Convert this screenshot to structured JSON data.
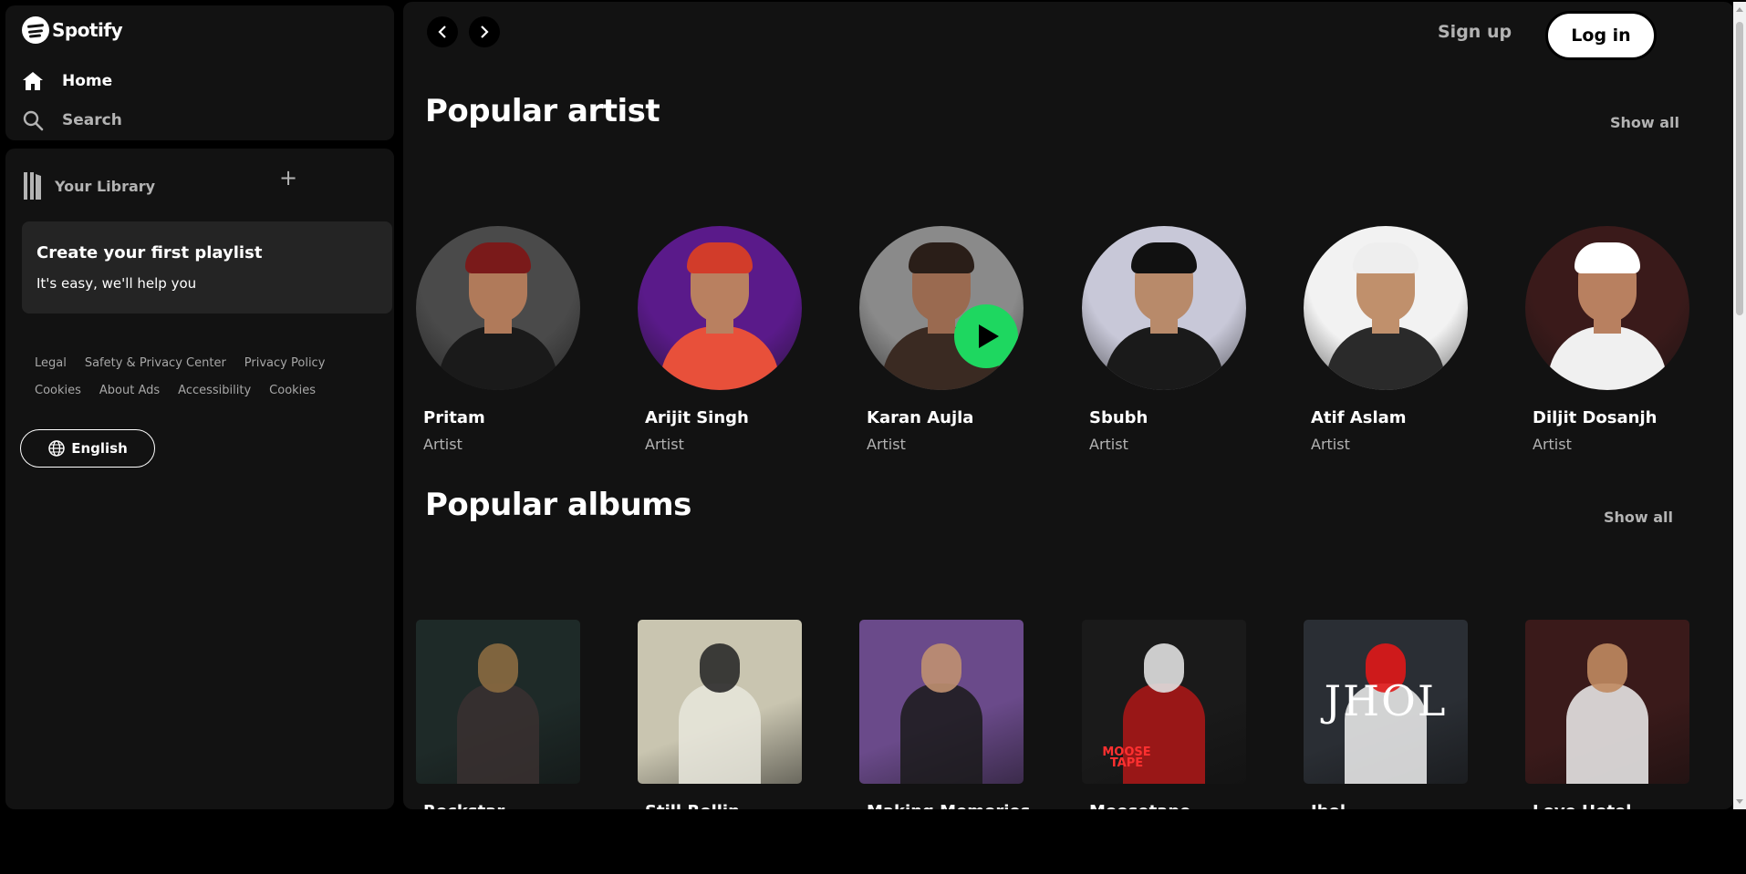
{
  "brand": {
    "name": "Spotify"
  },
  "nav": {
    "home": "Home",
    "search": "Search"
  },
  "library": {
    "title": "Your Library",
    "create_title": "Create your first playlist",
    "create_sub": "It's easy, we'll help you"
  },
  "legal_links": {
    "row1": [
      "Legal",
      "Safety & Privacy Center",
      "Privacy Policy"
    ],
    "row2": [
      "Cookies",
      "About Ads",
      "Accessibility",
      "Cookies"
    ]
  },
  "language": {
    "label": "English"
  },
  "topbar": {
    "signup": "Sign up",
    "login": "Log in"
  },
  "sections": {
    "artists": {
      "title": "Popular artist",
      "show_all": "Show all"
    },
    "albums": {
      "title": "Popular albums",
      "show_all": "Show all"
    }
  },
  "artists": [
    {
      "name": "Pritam",
      "sub": "Artist",
      "bg": "#4a4a4a",
      "skin": "#b07a5a",
      "cloth": "#1a1a1a",
      "accent": "#7a1a1a"
    },
    {
      "name": "Arijit Singh",
      "sub": "Artist",
      "bg": "#5a1a8a",
      "skin": "#b98060",
      "cloth": "#e8503a",
      "accent": "#d23c2a"
    },
    {
      "name": "Karan Aujla",
      "sub": "Artist",
      "bg": "#8a8a8a",
      "skin": "#9a6a50",
      "cloth": "#3a2a22",
      "accent": "#2a1e18"
    },
    {
      "name": "Sbubh",
      "sub": "Artist",
      "bg": "#c8c8d8",
      "skin": "#b88a6a",
      "cloth": "#1a1a1a",
      "accent": "#111111"
    },
    {
      "name": "Atif Aslam",
      "sub": "Artist",
      "bg": "#f2f2f2",
      "skin": "#c0906c",
      "cloth": "#2a2a2a",
      "accent": "#eeeeee"
    },
    {
      "name": "Diljit Dosanjh",
      "sub": "Artist",
      "bg": "#3a1a1a",
      "skin": "#b88060",
      "cloth": "#f0f0f0",
      "accent": "#ffffff"
    }
  ],
  "albums": [
    {
      "name": "Rockstar...",
      "bg": "#1e2a28",
      "fg": "#3a3030",
      "accent": "#8a6a40"
    },
    {
      "name": "Still Rollin",
      "bg": "#c9c5b0",
      "fg": "#e8e6dc",
      "accent": "#2a2a2a"
    },
    {
      "name": "Making Memories",
      "bg": "#6a4a8a",
      "fg": "#1a1a1a",
      "accent": "#c09070"
    },
    {
      "name": "Moosetape",
      "bg": "#1a1a1a",
      "fg": "#b01818",
      "accent": "#e0e0e0"
    },
    {
      "name": "Jhol",
      "bg": "#2a2e34",
      "fg": "#f0f0f0",
      "accent": "#e01818"
    },
    {
      "name": "Love Hotel",
      "bg": "#3a1a1a",
      "fg": "#f0f0f0",
      "accent": "#c08a60"
    }
  ],
  "album_texts": {
    "jhol_logo": "JHOL",
    "moosetape_logo": "MOOSE TAPE"
  },
  "colors": {
    "accent_green": "#1ed760",
    "bg_main": "#121212",
    "bg_card": "#242424"
  },
  "icons": [
    "spotify-logo-icon",
    "home-icon",
    "search-icon",
    "library-icon",
    "plus-icon",
    "globe-icon",
    "chevron-left-icon",
    "chevron-right-icon",
    "play-icon"
  ]
}
